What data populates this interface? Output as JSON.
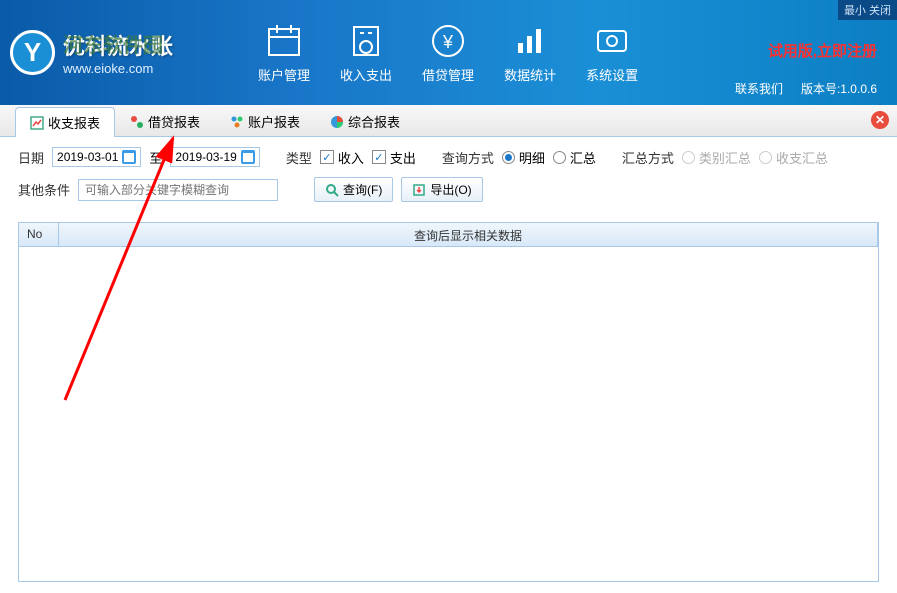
{
  "titlebar": {
    "text": "最小 关闭"
  },
  "logo": {
    "watermark": "河东软件园",
    "app_title": "优科流水账",
    "website": "www.eioke.com"
  },
  "nav": {
    "items": [
      {
        "label": "账户管理"
      },
      {
        "label": "收入支出"
      },
      {
        "label": "借贷管理"
      },
      {
        "label": "数据统计"
      },
      {
        "label": "系统设置"
      }
    ]
  },
  "header_right": {
    "trial": "试用版,立即注册",
    "contact": "联系我们",
    "version_label": "版本号:",
    "version": "1.0.0.6"
  },
  "tabs": {
    "items": [
      {
        "label": "收支报表"
      },
      {
        "label": "借贷报表"
      },
      {
        "label": "账户报表"
      },
      {
        "label": "综合报表"
      }
    ]
  },
  "filters": {
    "date_label": "日期",
    "date_from": "2019-03-01",
    "date_to_label": "至",
    "date_to": "2019-03-19",
    "type_label": "类型",
    "type_income": "收入",
    "type_expense": "支出",
    "query_mode_label": "查询方式",
    "query_mode_detail": "明细",
    "query_mode_summary": "汇总",
    "summary_mode_label": "汇总方式",
    "summary_by_category": "类别汇总",
    "summary_by_io": "收支汇总",
    "other_cond_label": "其他条件",
    "other_cond_placeholder": "可输入部分关键字模糊查询",
    "query_btn": "查询(F)",
    "export_btn": "导出(O)"
  },
  "table": {
    "col_no": "No",
    "empty_message": "查询后显示相关数据"
  }
}
